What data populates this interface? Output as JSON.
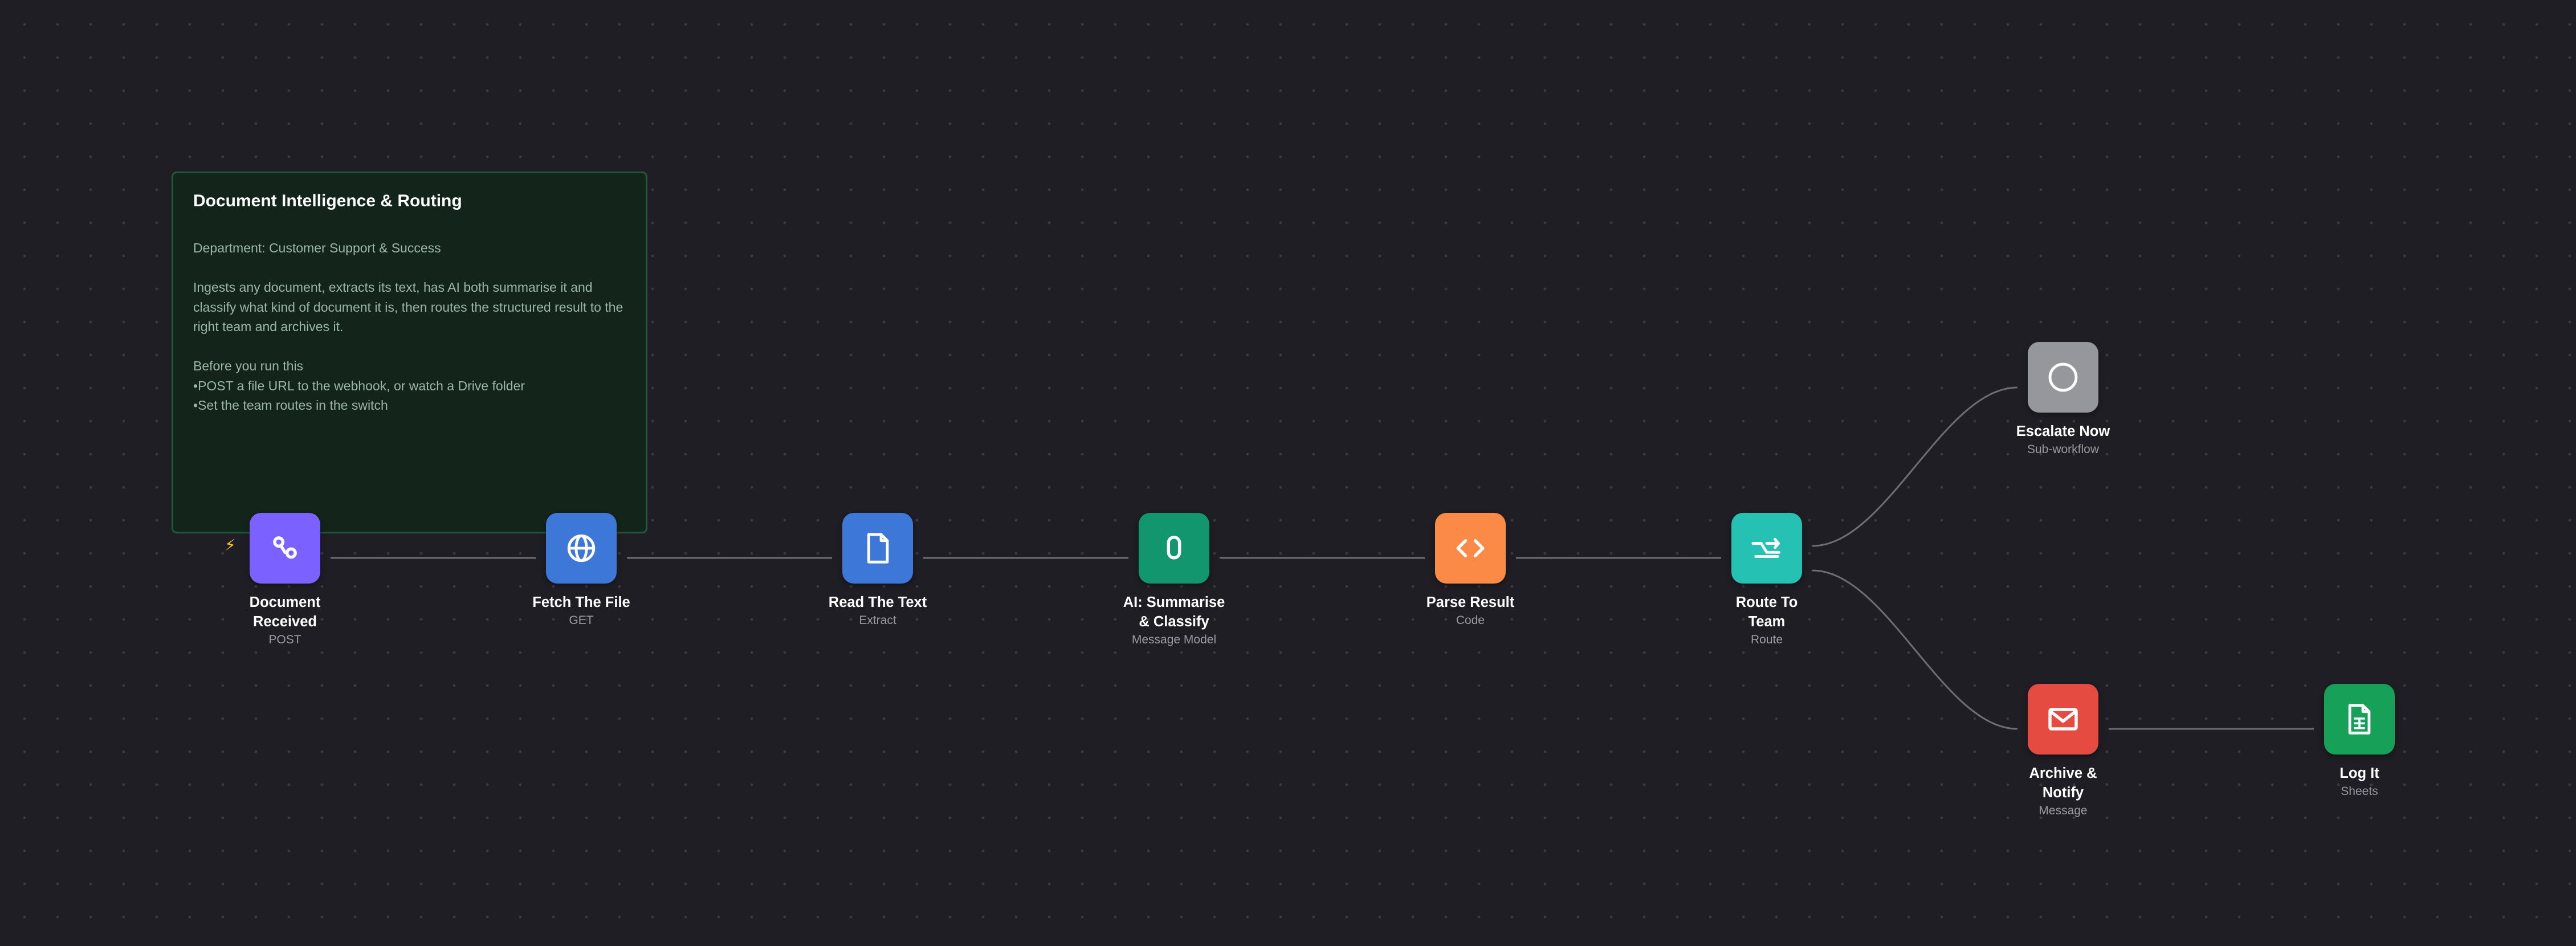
{
  "note": {
    "title": "Document Intelligence & Routing",
    "department": "Department: Customer Support & Success",
    "description": "Ingests any document, extracts its text, has AI both summarise it and classify what kind of document it is, then routes the structured result to the right team and archives it.",
    "before_heading": "Before you run this",
    "before_items": [
      "POST a file URL to the webhook, or watch a Drive folder",
      "Set the team routes in the switch"
    ]
  },
  "trigger_icon": "lightning-bolt-icon",
  "nodes": [
    {
      "id": "document-received",
      "name": "Document Received",
      "sub": "POST",
      "icon": "webhook-icon",
      "color": "#7b61ff"
    },
    {
      "id": "fetch-the-file",
      "name": "Fetch The File",
      "sub": "GET",
      "icon": "globe-icon",
      "color": "#3d77d8"
    },
    {
      "id": "read-the-text",
      "name": "Read The Text",
      "sub": "Extract",
      "icon": "file-icon",
      "color": "#3d77d8"
    },
    {
      "id": "ai-summarise-classify",
      "name": "AI: Summarise & Classify",
      "sub": "Message Model",
      "icon": "ai-model-icon",
      "color": "#12966e"
    },
    {
      "id": "parse-result",
      "name": "Parse Result",
      "sub": "Code",
      "icon": "code-icon",
      "color": "#fa8a45"
    },
    {
      "id": "route-to-team",
      "name": "Route To Team",
      "sub": "Route",
      "icon": "switch-icon",
      "color": "#25c1b3"
    },
    {
      "id": "escalate-now",
      "name": "Escalate Now",
      "sub": "Sub-workflow",
      "icon": "circle-icon",
      "color": "#96979d"
    },
    {
      "id": "archive-notify",
      "name": "Archive & Notify",
      "sub": "Message",
      "icon": "mail-icon",
      "color": "#e64b41"
    },
    {
      "id": "log-it",
      "name": "Log It",
      "sub": "Sheets",
      "icon": "sheets-icon",
      "color": "#16a058"
    }
  ],
  "connections": [
    [
      "document-received",
      "fetch-the-file"
    ],
    [
      "fetch-the-file",
      "read-the-text"
    ],
    [
      "read-the-text",
      "ai-summarise-classify"
    ],
    [
      "ai-summarise-classify",
      "parse-result"
    ],
    [
      "parse-result",
      "route-to-team"
    ],
    [
      "route-to-team",
      "escalate-now"
    ],
    [
      "route-to-team",
      "archive-notify"
    ],
    [
      "archive-notify",
      "log-it"
    ]
  ]
}
